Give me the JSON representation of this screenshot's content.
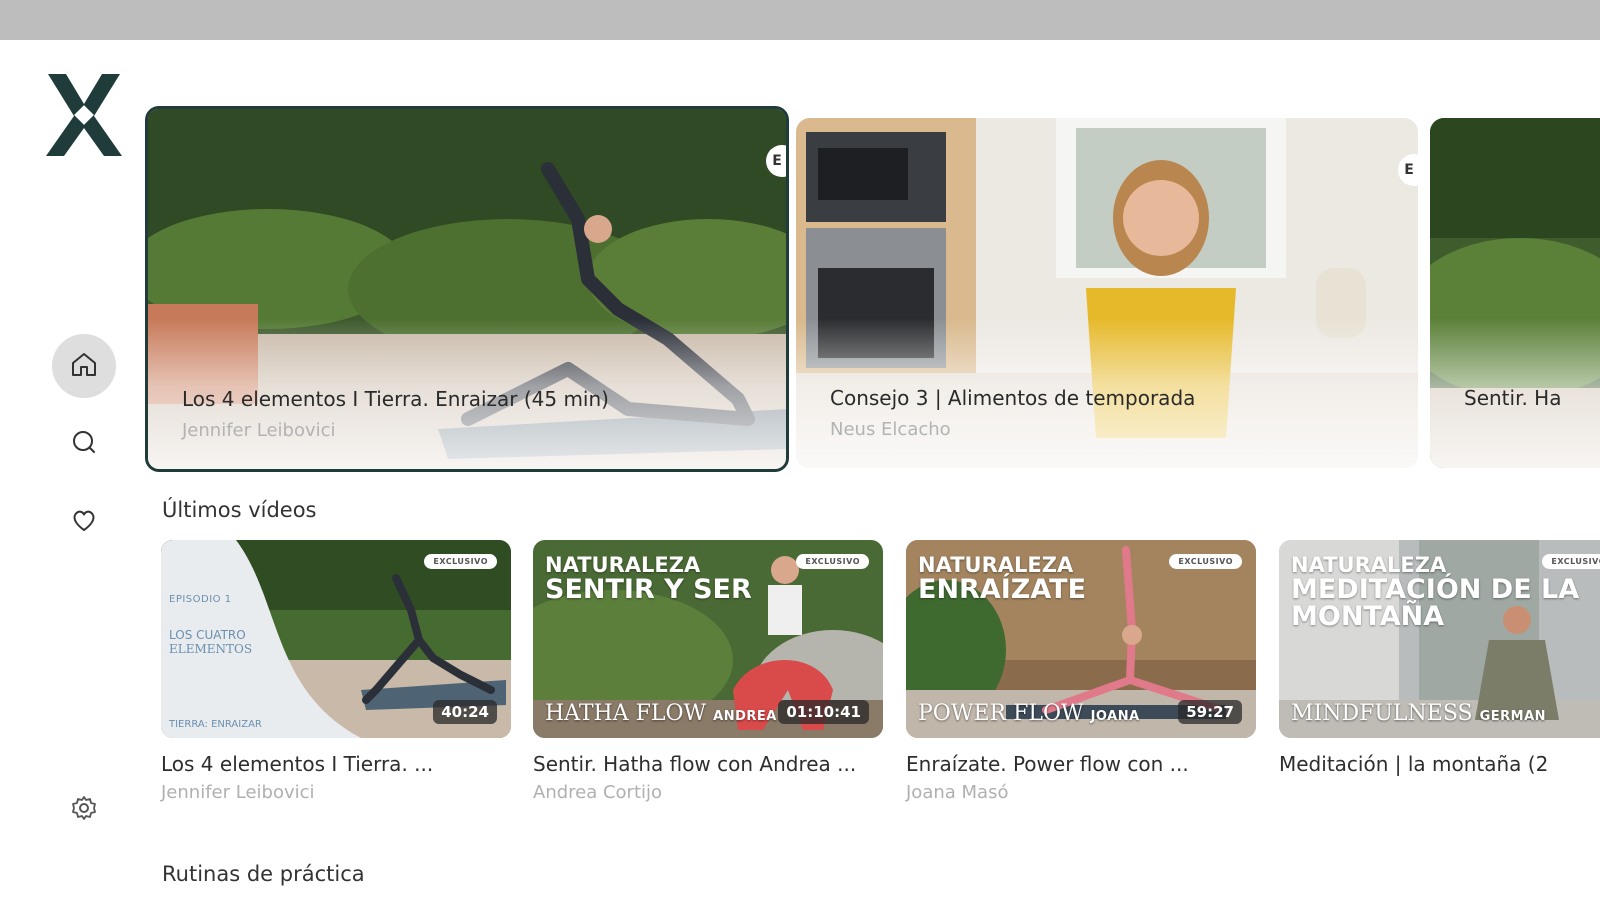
{
  "sidebar": {
    "logo_icon": "brand-x-logo",
    "items": [
      {
        "name": "home",
        "icon": "home-icon",
        "active": true
      },
      {
        "name": "search",
        "icon": "search-icon",
        "active": false
      },
      {
        "name": "favorites",
        "icon": "heart-icon",
        "active": false
      },
      {
        "name": "settings",
        "icon": "gear-icon",
        "active": false
      }
    ]
  },
  "colors": {
    "brand": "#1f3b3a",
    "top_bar": "#bdbdbd",
    "active_nav": "#dedede"
  },
  "hero": [
    {
      "title": "Los 4 elementos I Tierra. Enraizar (45 min)",
      "subtitle": "Jennifer Leibovici",
      "focused": true
    },
    {
      "title": "Consejo 3 | Alimentos de temporada",
      "subtitle": "Neus Elcacho",
      "focused": false
    },
    {
      "title": "Sentir. Ha",
      "subtitle": "",
      "focused": false
    }
  ],
  "sections": {
    "latest_title": "Últimos vídeos",
    "routines_title": "Rutinas de práctica"
  },
  "latest_videos": [
    {
      "title": "Los 4 elementos I Tierra. ...",
      "author": "Jennifer Leibovici",
      "duration": "40:24",
      "badge": "EXCLUSIVO",
      "overlay_episode": "EPISODIO 1",
      "overlay_title_1": "LOS CUATRO",
      "overlay_title_2": "ELEMENTOS",
      "overlay_footer": "TIERRA: ENRAIZAR"
    },
    {
      "title": "Sentir. Hatha flow con Andrea ...",
      "author": "Andrea Cortijo",
      "duration": "01:10:41",
      "badge": "EXCLUSIVO",
      "category": "NATURALEZA",
      "headline": "SENTIR Y SER",
      "style": "HATHA FLOW",
      "style_teacher": "ANDREA"
    },
    {
      "title": "Enraízate. Power flow con ...",
      "author": "Joana Masó",
      "duration": "59:27",
      "badge": "EXCLUSIVO",
      "category": "NATURALEZA",
      "headline": "ENRAÍZATE",
      "style": "POWER FLOW",
      "style_teacher": "JOANA"
    },
    {
      "title": "Meditación | la montaña (2",
      "author": "",
      "duration": "",
      "badge": "EXCLUSIVO",
      "category": "NATURALEZA",
      "headline": "MEDITACIÓN DE LA MONTAÑA",
      "style": "MINDFULNESS",
      "style_teacher": "GERMAN"
    }
  ]
}
